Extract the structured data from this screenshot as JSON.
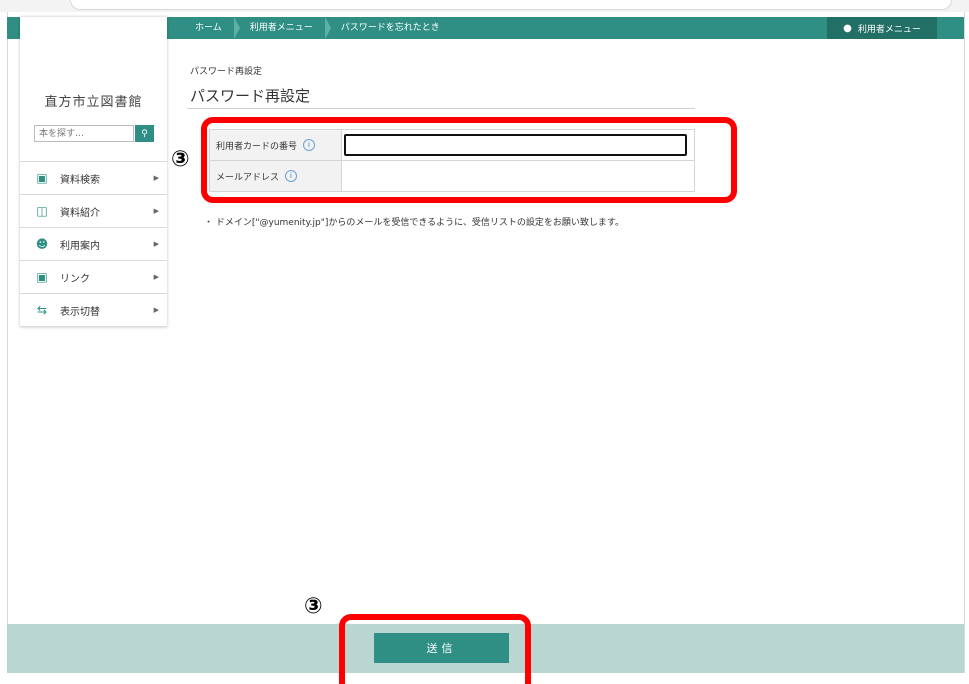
{
  "nav": {
    "breadcrumbs": [
      "ホーム",
      "利用者メニュー",
      "パスワードを忘れたとき"
    ],
    "user_menu_label": "利用者メニュー"
  },
  "sidebar": {
    "library_name": "直方市立図書館",
    "search_placeholder": "本を探す…",
    "items": [
      {
        "label": "資料検索",
        "icon": "book-search-icon"
      },
      {
        "label": "資料紹介",
        "icon": "open-book-icon"
      },
      {
        "label": "利用案内",
        "icon": "user-guide-icon"
      },
      {
        "label": "リンク",
        "icon": "link-icon"
      },
      {
        "label": "表示切替",
        "icon": "swap-icon"
      }
    ]
  },
  "main": {
    "sub_title": "パスワード再設定",
    "page_title": "パスワード再設定",
    "fields": [
      {
        "label": "利用者カードの番号",
        "value": ""
      },
      {
        "label": "メールアドレス",
        "value": ""
      }
    ],
    "note": "・ ドメイン[\"@yumenity.jp\"]からのメールを受信できるように、受信リストの設定をお願い致します。",
    "submit_label": "送信"
  },
  "annotations": {
    "marker_1": "③",
    "marker_2": "③",
    "color": "#ff0000"
  },
  "colors": {
    "accent": "#2f8f84",
    "bottom_bar": "#b9d6d1"
  }
}
